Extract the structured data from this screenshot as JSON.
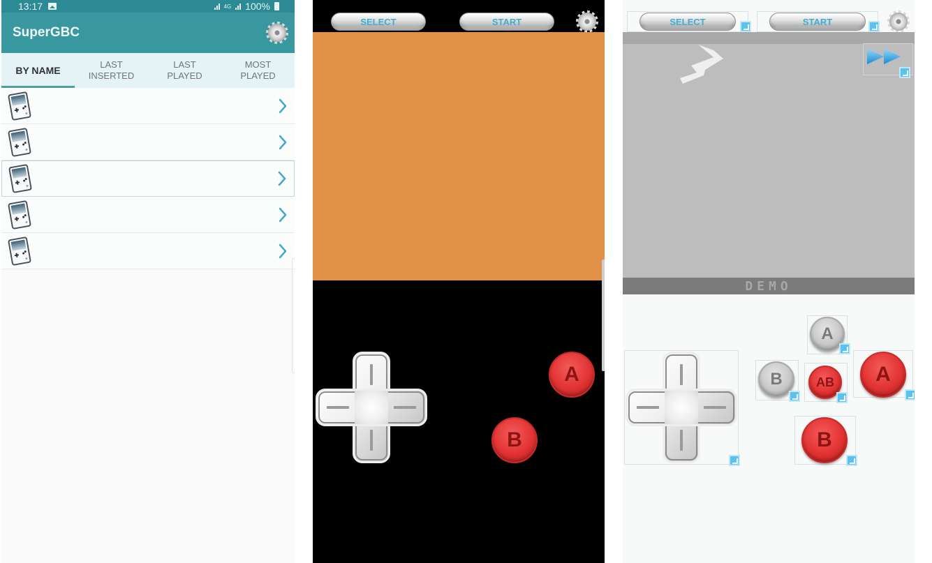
{
  "screens": {
    "rom_list": {
      "status_bar": {
        "time": "13:17",
        "network": "4G",
        "battery": "100%"
      },
      "app_title": "SuperGBC",
      "settings_icon": "gear-icon",
      "tabs": [
        {
          "label": "BY NAME",
          "active": true
        },
        {
          "label": "LAST\nINSERTED",
          "active": false
        },
        {
          "label": "LAST\nPLAYED",
          "active": false
        },
        {
          "label": "MOST\nPLAYED",
          "active": false
        }
      ],
      "rom_items": [
        {
          "title": "",
          "icon": "gameboy-icon",
          "focused": false
        },
        {
          "title": "",
          "icon": "gameboy-icon",
          "focused": false
        },
        {
          "title": "",
          "icon": "gameboy-icon",
          "focused": true
        },
        {
          "title": "",
          "icon": "gameboy-icon",
          "focused": false
        },
        {
          "title": "",
          "icon": "gameboy-icon",
          "focused": false
        }
      ]
    },
    "emulator": {
      "select_label": "SELECT",
      "start_label": "START",
      "settings_icon": "gear-icon",
      "a_label": "A",
      "b_label": "B",
      "screen_color": "#e09047"
    },
    "layout_editor": {
      "select_label": "SELECT",
      "start_label": "START",
      "settings_icon": "gear-icon",
      "fast_forward_icon": "fast-forward-icon",
      "demo_text": "DEMO",
      "turbo_a_label": "A",
      "turbo_b_label": "B",
      "ab_label": "AB",
      "a_label": "A",
      "b_label": "B"
    }
  },
  "colors": {
    "accent_teal": "#38979f",
    "status_teal": "#2b8a93",
    "chevron": "#41a9c9",
    "button_text_blue": "#41acd0",
    "red_button": "#e23333",
    "resize_handle": "#5bc2ee"
  }
}
